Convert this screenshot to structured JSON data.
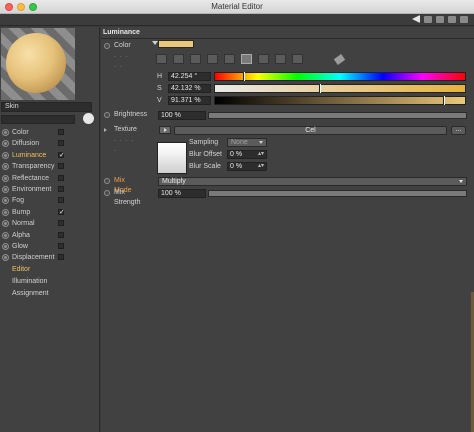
{
  "window": {
    "title": "Material Editor"
  },
  "material": {
    "name": "Skin",
    "preview_color": "#e6c27b"
  },
  "channels": [
    {
      "label": "Color",
      "checked": false,
      "active": false
    },
    {
      "label": "Diffusion",
      "checked": false,
      "active": false
    },
    {
      "label": "Luminance",
      "checked": true,
      "active": true
    },
    {
      "label": "Transparency",
      "checked": false,
      "active": false
    },
    {
      "label": "Reflectance",
      "checked": false,
      "active": false
    },
    {
      "label": "Environment",
      "checked": false,
      "active": false
    },
    {
      "label": "Fog",
      "checked": false,
      "active": false
    },
    {
      "label": "Bump",
      "checked": true,
      "active": false
    },
    {
      "label": "Normal",
      "checked": false,
      "active": false
    },
    {
      "label": "Alpha",
      "checked": false,
      "active": false
    },
    {
      "label": "Glow",
      "checked": false,
      "active": false
    },
    {
      "label": "Displacement",
      "checked": false,
      "active": false
    }
  ],
  "sections": [
    {
      "label": "Editor",
      "active": true
    },
    {
      "label": "Illumination",
      "active": false
    },
    {
      "label": "Assignment",
      "active": false
    }
  ],
  "luminance": {
    "header": "Luminance",
    "color_label": "Color",
    "color_swatch": "#ebc879",
    "hsv": [
      {
        "label": "H",
        "value": "42.254 °",
        "fraction": 0.117
      },
      {
        "label": "S",
        "value": "42.132 %",
        "fraction": 0.421
      },
      {
        "label": "V",
        "value": "91.371 %",
        "fraction": 0.914
      }
    ],
    "brightness_label": "Brightness",
    "brightness_value": "100 %",
    "brightness_fraction": 1.0,
    "texture_label": "Texture",
    "texture_name": "Cel",
    "texture_more": "...",
    "sampling_label": "Sampling",
    "sampling_value": "None",
    "blur_offset_label": "Blur Offset",
    "blur_offset_value": "0 %",
    "blur_scale_label": "Blur Scale",
    "blur_scale_value": "0 %",
    "mix_mode_label": "Mix Mode",
    "mix_mode_value": "Multiply",
    "mix_strength_label": "Mix Strength",
    "mix_strength_value": "100 %",
    "mix_strength_fraction": 1.0
  },
  "colors": {
    "accent": "#f0c060",
    "mix_label": "#f0a040"
  }
}
